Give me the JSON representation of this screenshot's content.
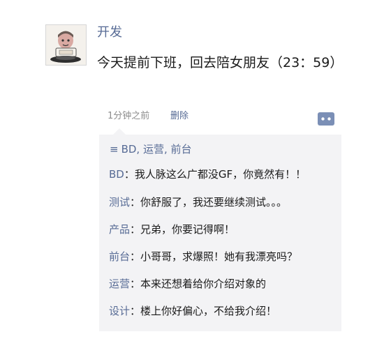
{
  "post": {
    "author": "开发",
    "content": "今天提前下班，回去陪女朋友（23：59）",
    "time": "1分钟之前",
    "delete_label": "删除"
  },
  "likes": {
    "icon": "≡",
    "names": "BD, 运营, 前台"
  },
  "comments": [
    {
      "name": "BD",
      "sep": "：",
      "text": "我人脉这么广都没GF，你竟然有！！"
    },
    {
      "name": "测试",
      "sep": "：",
      "text": "你舒服了，我还要继续测试。。。"
    },
    {
      "name": "产品",
      "sep": "：",
      "text": "兄弟，你要记得啊！"
    },
    {
      "name": "前台",
      "sep": "：",
      "text": "小哥哥，求爆照！她有我漂亮吗？"
    },
    {
      "name": "运营",
      "sep": "：",
      "text": "本来还想着给你介绍对象的"
    },
    {
      "name": "设计",
      "sep": "：",
      "text": "楼上你好偏心，不给我介绍！"
    }
  ],
  "colors": {
    "link": "#576b95",
    "text": "#1a1a1a",
    "muted": "#8c8c8c",
    "comment_bg": "#f3f3f5"
  },
  "icons": {
    "avatar": "cartoon-avatar-icon",
    "comment_button": "comment-more-icon",
    "like": "like-list-icon"
  }
}
